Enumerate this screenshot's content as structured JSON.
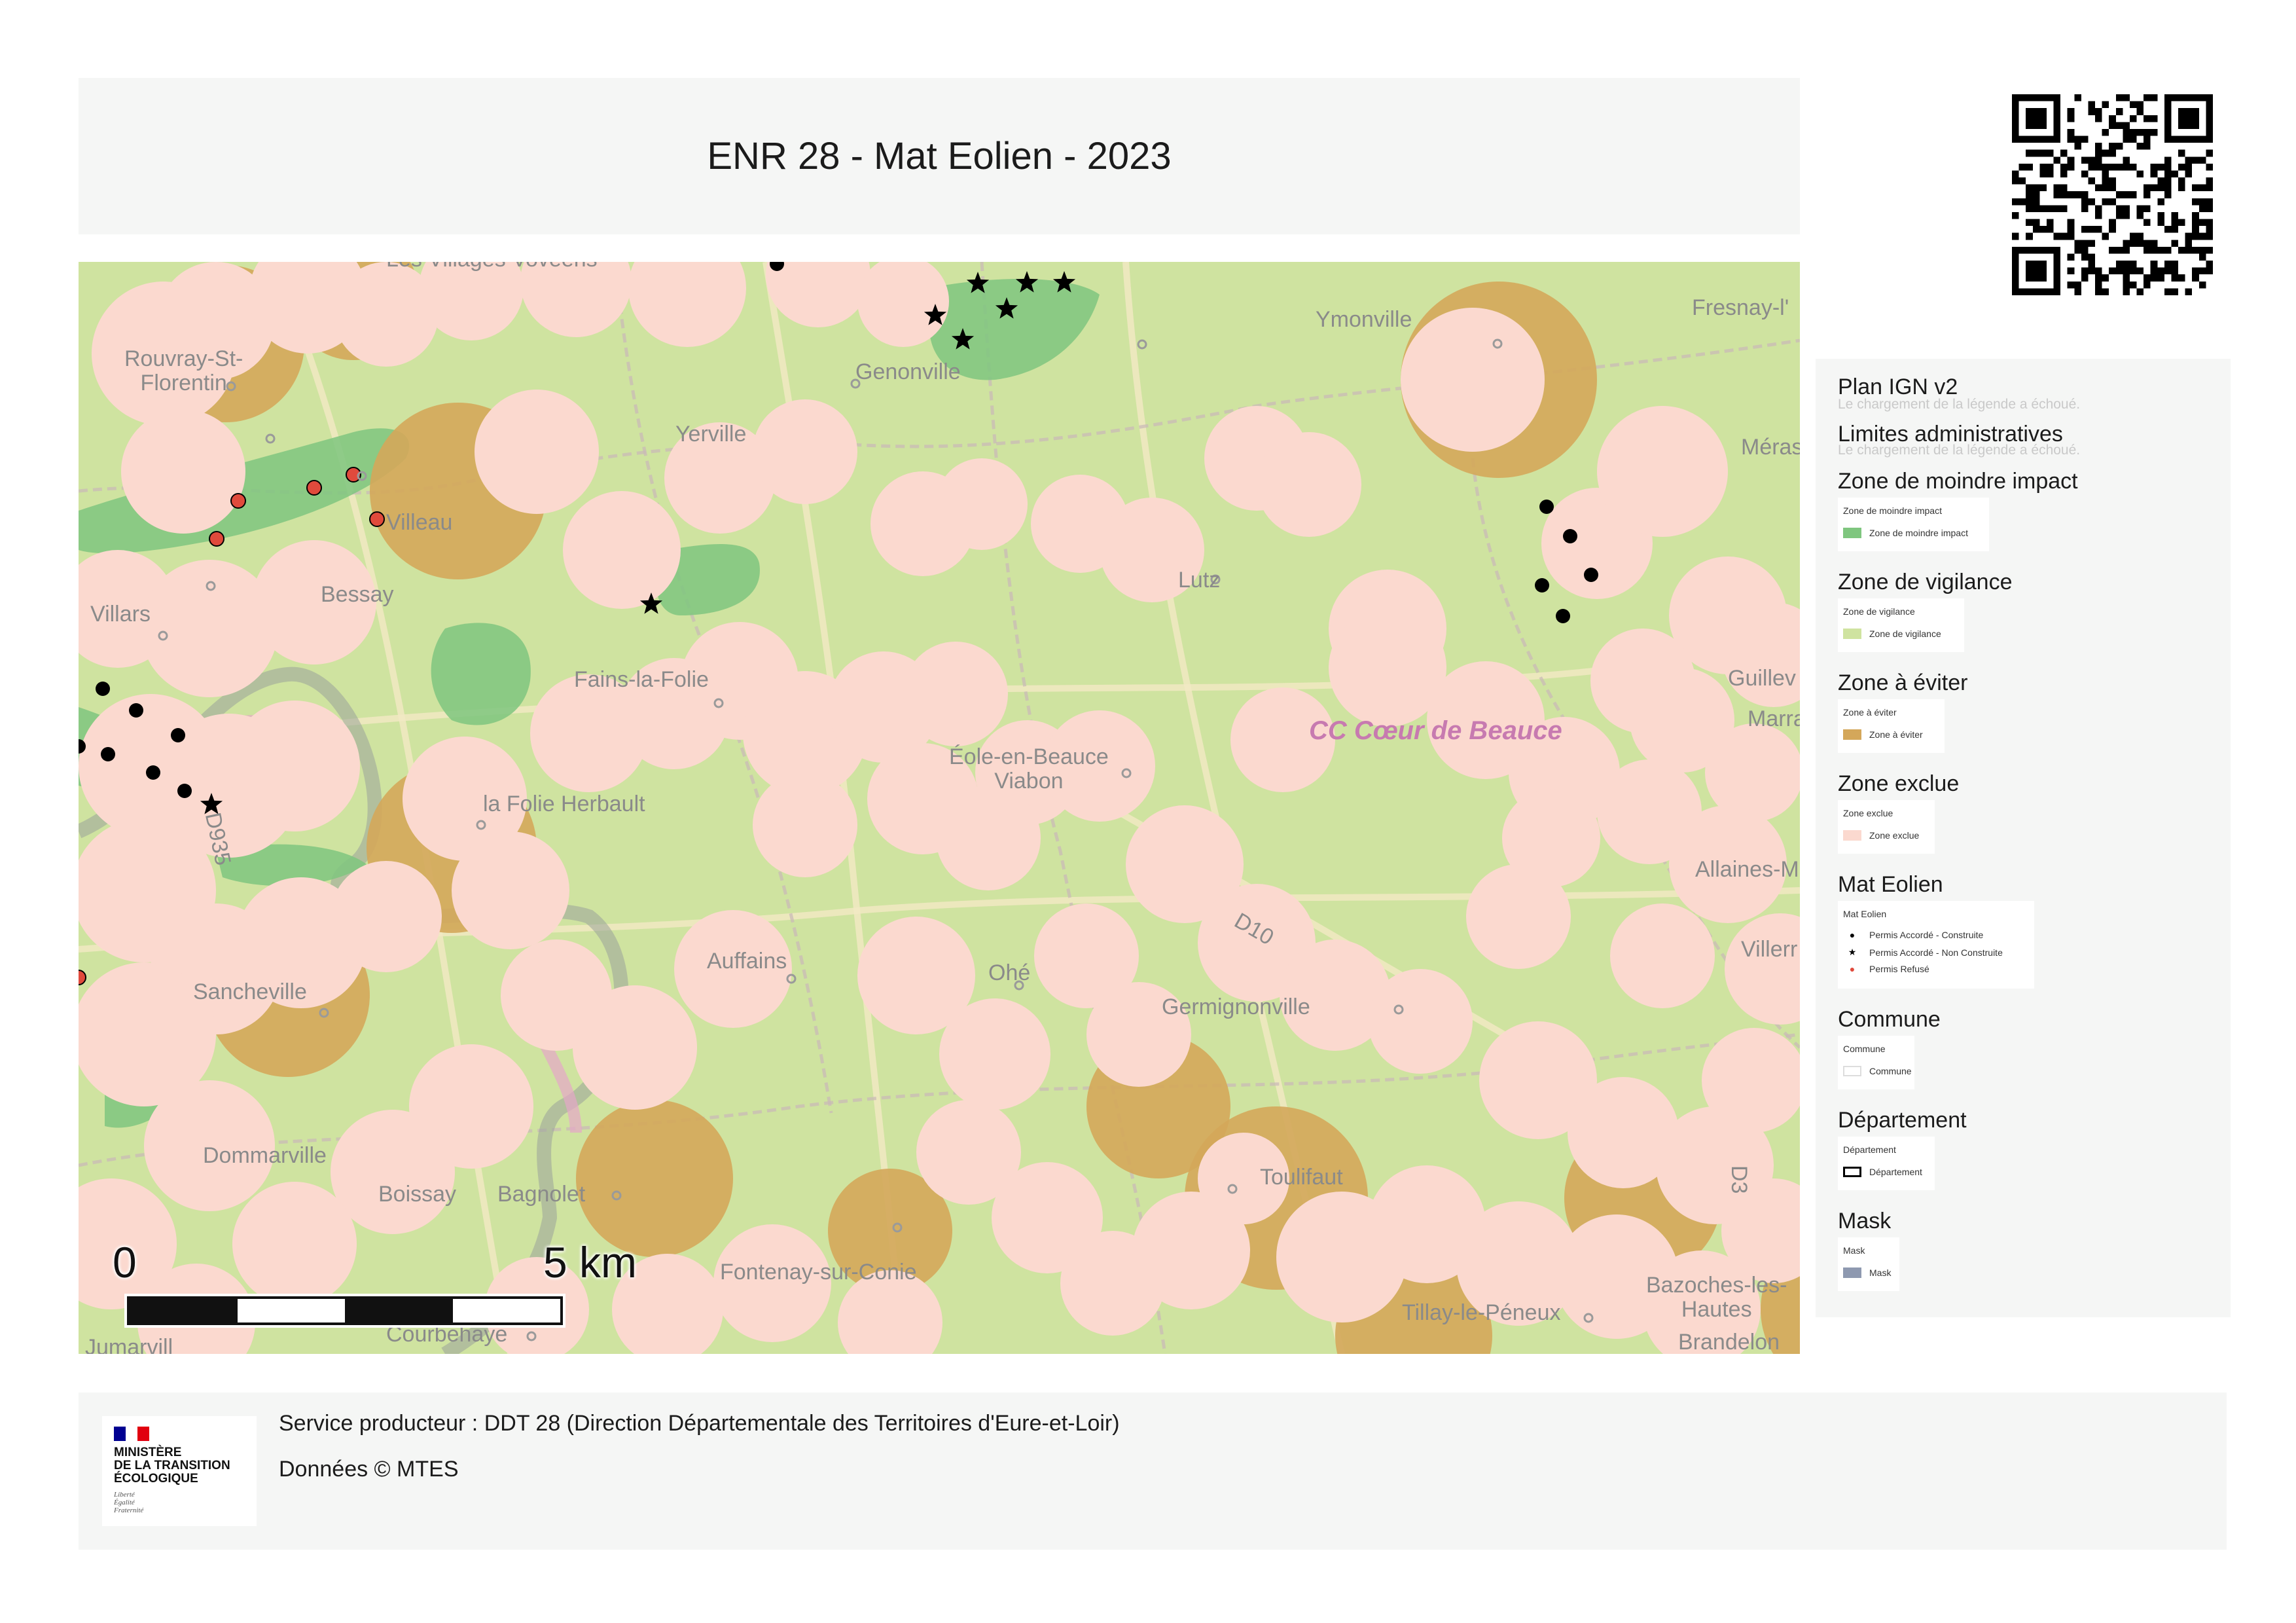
{
  "title": "ENR 28 - Mat Eolien - 2023",
  "map": {
    "places": [
      {
        "label": "Les Villages Vovéens",
        "name": "place-les-villages-voveens"
      },
      {
        "label": "Rouvray-St-\nFlorentin",
        "name": "place-rouvray-st-florentin"
      },
      {
        "label": "Genonville",
        "name": "place-genonville"
      },
      {
        "label": "Ymonville",
        "name": "place-ymonville"
      },
      {
        "label": "Fresnay-l'",
        "name": "place-fresnay"
      },
      {
        "label": "Yerville",
        "name": "place-yerville"
      },
      {
        "label": "Méras",
        "name": "place-meras"
      },
      {
        "label": "Villeau",
        "name": "place-villeau"
      },
      {
        "label": "Bessay",
        "name": "place-bessay"
      },
      {
        "label": "Villars",
        "name": "place-villars"
      },
      {
        "label": "Lutz",
        "name": "place-lutz"
      },
      {
        "label": "Fains-la-Folie",
        "name": "place-fains-la-folie"
      },
      {
        "label": "Guillev",
        "name": "place-guillev"
      },
      {
        "label": "Marra",
        "name": "place-marra"
      },
      {
        "label": "Éole-en-Beauce\nViabon",
        "name": "place-eole-en-beauce"
      },
      {
        "label": "la Folie Herbault",
        "name": "place-la-folie-herbault"
      },
      {
        "label": "D935",
        "name": "road-d935"
      },
      {
        "label": "Allaines-M",
        "name": "place-allaines"
      },
      {
        "label": "D10",
        "name": "road-d10"
      },
      {
        "label": "Villerr",
        "name": "place-villerr"
      },
      {
        "label": "Auffains",
        "name": "place-auffains"
      },
      {
        "label": "Ohé",
        "name": "place-ohe"
      },
      {
        "label": "Sancheville",
        "name": "place-sancheville"
      },
      {
        "label": "Germignonville",
        "name": "place-germignonville"
      },
      {
        "label": "Dommarville",
        "name": "place-dommarville"
      },
      {
        "label": "Boissay",
        "name": "place-boissay"
      },
      {
        "label": "Bagnolet",
        "name": "place-bagnolet"
      },
      {
        "label": "Toulifaut",
        "name": "place-toulifaut"
      },
      {
        "label": "Fontenay-sur-Conie",
        "name": "place-fontenay-sur-conie"
      },
      {
        "label": "Tillay-le-Péneux",
        "name": "place-tillay-le-peneux"
      },
      {
        "label": "Bazoches-les-\nHautes",
        "name": "place-bazoches"
      },
      {
        "label": "Brandelon",
        "name": "place-brandelon"
      },
      {
        "label": "Courbehaye",
        "name": "place-courbehaye"
      },
      {
        "label": "Jumarvill",
        "name": "place-jumarvill"
      },
      {
        "label": "D3",
        "name": "road-d3"
      }
    ],
    "epci_label": "CC Cœur de Beauce",
    "scale": {
      "start": "0",
      "end": "5 km"
    },
    "colors": {
      "base": "#cfe3a0",
      "moindre_impact": "#7fc67f",
      "vigilance": "#cfe3a0",
      "eviter": "#d4a75a",
      "exclue": "#fbd9cf",
      "constructed": "#000000",
      "refused": "#e04a3c"
    }
  },
  "legend": {
    "sections": [
      {
        "title": "Plan IGN v2",
        "failure": "Le chargement de la légende a échoué."
      },
      {
        "title": "Limites administratives",
        "failure": "Le chargement de la légende a échoué."
      },
      {
        "title": "Zone de moindre impact",
        "box_title": "Zone de moindre impact",
        "items": [
          {
            "label": "Zone de moindre impact",
            "swatch": "fill",
            "color": "#7fc67f"
          }
        ]
      },
      {
        "title": "Zone de vigilance",
        "box_title": "Zone de vigilance",
        "items": [
          {
            "label": "Zone de vigilance",
            "swatch": "fill",
            "color": "#cfe3a0"
          }
        ]
      },
      {
        "title": "Zone à éviter",
        "box_title": "Zone à éviter",
        "items": [
          {
            "label": "Zone à éviter",
            "swatch": "fill",
            "color": "#d4a75a"
          }
        ]
      },
      {
        "title": "Zone exclue",
        "box_title": "Zone exclue",
        "items": [
          {
            "label": "Zone exclue",
            "swatch": "fill",
            "color": "#fbd9cf"
          }
        ]
      },
      {
        "title": "Mat Eolien",
        "box_title": "Mat Eolien",
        "items": [
          {
            "label": "Permis Accordé - Construite",
            "swatch": "dot",
            "color": "#000000"
          },
          {
            "label": "Permis Accordé - Non Construite",
            "swatch": "star",
            "color": "#000000"
          },
          {
            "label": "Permis Refusé",
            "swatch": "dot",
            "color": "#e04a3c"
          }
        ]
      },
      {
        "title": "Commune",
        "box_title": "Commune",
        "items": [
          {
            "label": "Commune",
            "swatch": "outline-light",
            "color": "#dddddd"
          }
        ]
      },
      {
        "title": "Département",
        "box_title": "Département",
        "items": [
          {
            "label": "Département",
            "swatch": "outline",
            "color": "#000000"
          }
        ]
      },
      {
        "title": "Mask",
        "box_title": "Mask",
        "items": [
          {
            "label": "Mask",
            "swatch": "fill",
            "color": "#8e99b0"
          }
        ]
      }
    ]
  },
  "footer": {
    "producer": "Service producteur : DDT 28 (Direction Départementale des Territoires d'Eure-et-Loir)",
    "data_credit": "Données © MTES",
    "logo_text": "MINISTÈRE\nDE LA TRANSITION\nÉCOLOGIQUE",
    "logo_motto": "Liberté\nÉgalité\nFraternité"
  }
}
